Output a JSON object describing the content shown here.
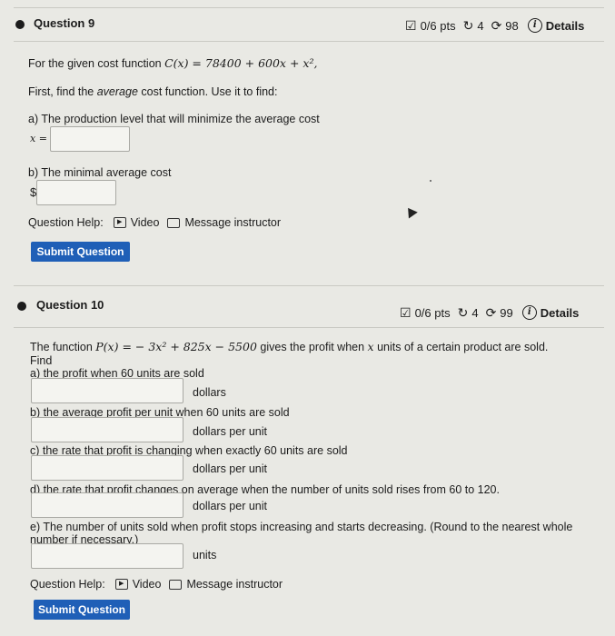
{
  "q9": {
    "title": "Question 9",
    "pts": "0/6 pts",
    "retries": "4",
    "attempts": "98",
    "details": "Details",
    "intro_prefix": "For the given cost function ",
    "intro_math": "C(x) = 78400 + 600x + x²,",
    "instruction_a": "First, find the ",
    "instruction_em": "average",
    "instruction_b": " cost function. Use it to find:",
    "part_a": "a) The production level that will minimize the average cost",
    "part_a_var": "x =",
    "part_b": "b) The minimal average cost",
    "part_b_unit": "$",
    "help_label": "Question Help:",
    "help_video": "Video",
    "help_message": "Message instructor",
    "submit": "Submit Question"
  },
  "q10": {
    "title": "Question 10",
    "pts": "0/6 pts",
    "retries": "4",
    "attempts": "99",
    "details": "Details",
    "intro_prefix": "The function ",
    "intro_math": "P(x) = − 3x² + 825x − 5500",
    "intro_mid": " gives the profit when ",
    "intro_var": "x",
    "intro_suffix": " units of a certain product are sold.",
    "find": "Find",
    "part_a": "a) the profit when 60 units are sold",
    "part_a_unit": "dollars",
    "part_b": "b) the average profit per unit when 60 units are sold",
    "part_b_unit": "dollars per unit",
    "part_c": "c) the rate that profit is changing when exactly 60 units are sold",
    "part_c_unit": "dollars per unit",
    "part_d": "d) the rate that profit changes on average when the number of units sold rises from 60 to 120.",
    "part_d_unit": "dollars per unit",
    "part_e_line1": "e) The number of units sold when profit stops increasing and starts decreasing. (Round to the nearest whole",
    "part_e_line2": "number if necessary.)",
    "part_e_unit": "units",
    "help_label": "Question Help:",
    "help_video": "Video",
    "help_message": "Message instructor",
    "submit": "Submit Question"
  }
}
